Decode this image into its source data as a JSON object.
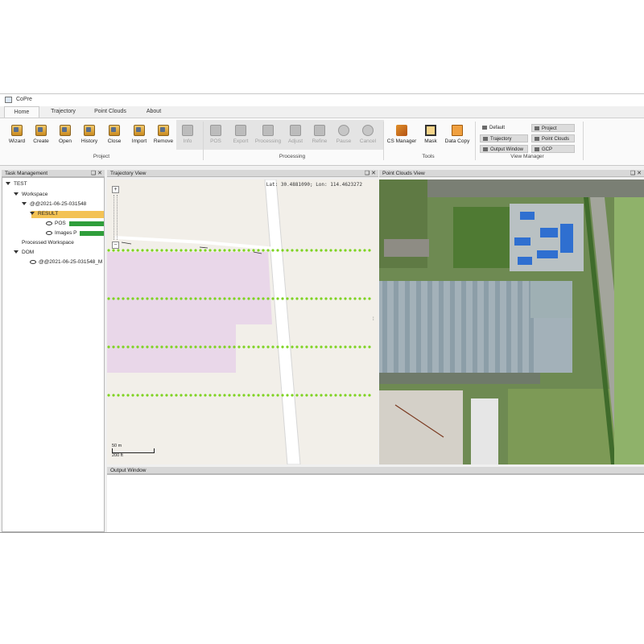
{
  "window": {
    "title": "CoPre"
  },
  "tabs": [
    {
      "label": "Home",
      "active": true
    },
    {
      "label": "Trajectory",
      "active": false
    },
    {
      "label": "Point Clouds",
      "active": false
    },
    {
      "label": "About",
      "active": false
    }
  ],
  "ribbon": {
    "project": {
      "label": "Project",
      "buttons": [
        {
          "label": "Wizard",
          "icon": "wizard-icon"
        },
        {
          "label": "Create",
          "icon": "create-icon"
        },
        {
          "label": "Open",
          "icon": "open-icon"
        },
        {
          "label": "History",
          "icon": "history-icon"
        },
        {
          "label": "Close",
          "icon": "close-project-icon"
        },
        {
          "label": "Import",
          "icon": "import-icon"
        },
        {
          "label": "Remove",
          "icon": "remove-icon"
        },
        {
          "label": "Info",
          "icon": "info-icon",
          "disabled": true
        }
      ]
    },
    "processing": {
      "label": "Processing",
      "buttons": [
        {
          "label": "POS",
          "icon": "pos-icon",
          "disabled": true
        },
        {
          "label": "Export",
          "icon": "export-icon",
          "disabled": true
        },
        {
          "label": "Processing",
          "icon": "processing-icon",
          "disabled": true
        },
        {
          "label": "Adjust",
          "icon": "adjust-icon",
          "disabled": true
        },
        {
          "label": "Refine",
          "icon": "refine-icon",
          "disabled": true
        },
        {
          "label": "Pause",
          "icon": "pause-icon",
          "disabled": true
        },
        {
          "label": "Cancel",
          "icon": "cancel-icon",
          "disabled": true
        }
      ]
    },
    "tools": {
      "label": "Tools",
      "buttons": [
        {
          "label": "CS Manager",
          "icon": "cs-manager-icon"
        },
        {
          "label": "Mask",
          "icon": "mask-icon"
        },
        {
          "label": "Data Copy",
          "icon": "data-copy-icon"
        }
      ]
    },
    "view_manager": {
      "label": "View Manager",
      "buttons": [
        {
          "label": "Default"
        },
        {
          "label": "Project"
        },
        {
          "label": "Trajectory"
        },
        {
          "label": "Point Clouds"
        },
        {
          "label": "Output Window"
        },
        {
          "label": "GCP"
        }
      ]
    }
  },
  "panels": {
    "task_management": "Task Management",
    "trajectory_view": "Trajectory View",
    "point_clouds_view": "Point Clouds View",
    "output_window": "Output Window",
    "controls": "❑ ✕"
  },
  "tree": {
    "root": "TEST",
    "workspace": "Workspace",
    "dataset": "@@2021-06-25-031548",
    "result": "RESULT",
    "pos": {
      "label": "POS",
      "progress": 1.0
    },
    "images": {
      "label": "Images P",
      "progress": 1.0
    },
    "processed": "Processed Workspace",
    "dom": "DOM",
    "dom_item": "@@2021-06-25-031548_M"
  },
  "trajectory": {
    "coords": "Lat: 30.4881090; Lon: 114.4623272",
    "scale_m": "50 m",
    "scale_ft": "200 ft",
    "zoom_in": "+",
    "zoom_out": "−"
  },
  "colors": {
    "trajectory_points": "#7ed321",
    "progress": "#2f9e3b",
    "selection": "#f3c254"
  }
}
